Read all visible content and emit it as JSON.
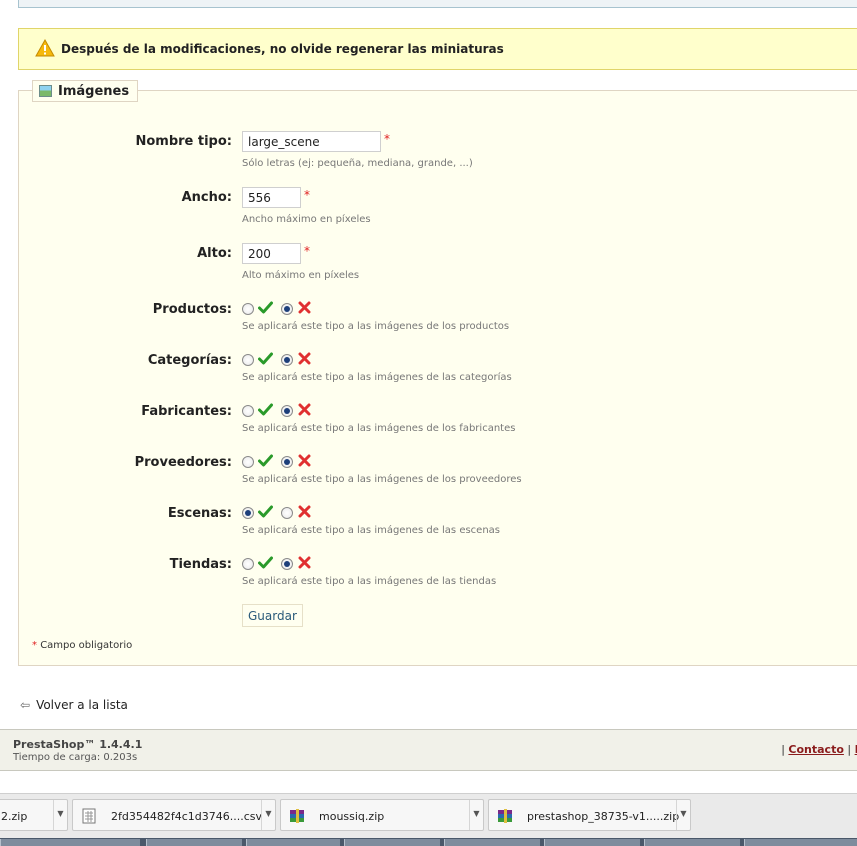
{
  "warning": {
    "text": "Después de la modificaciones, no olvide regenerar las miniaturas"
  },
  "form": {
    "legend": "Imágenes",
    "fields": [
      {
        "label": "Nombre tipo:",
        "value": "large_scene",
        "hint": "Sólo letras (ej: pequeña, mediana, grande, ...)"
      },
      {
        "label": "Ancho:",
        "value": "556",
        "hint": "Ancho máximo en píxeles"
      },
      {
        "label": "Alto:",
        "value": "200",
        "hint": "Alto máximo en píxeles"
      }
    ],
    "required_mark": "*",
    "toggles": [
      {
        "label": "Productos:",
        "enabled": false,
        "hint": "Se aplicará este tipo a las imágenes de los productos"
      },
      {
        "label": "Categorías:",
        "enabled": false,
        "hint": "Se aplicará este tipo a las imágenes de las categorías"
      },
      {
        "label": "Fabricantes:",
        "enabled": false,
        "hint": "Se aplicará este tipo a las imágenes de los fabricantes"
      },
      {
        "label": "Proveedores:",
        "enabled": false,
        "hint": "Se aplicará este tipo a las imágenes de los proveedores"
      },
      {
        "label": "Escenas:",
        "enabled": true,
        "hint": "Se aplicará este tipo a las imágenes de las escenas"
      },
      {
        "label": "Tiendas:",
        "enabled": false,
        "hint": "Se aplicará este tipo a las imágenes de las tiendas"
      }
    ],
    "save_label": "Guardar",
    "required_note": "Campo obligatorio"
  },
  "back_link": "Volver a la lista",
  "footer": {
    "brand": "PrestaShop™ 1.4.4.1",
    "load_time": "Tiempo de carga: 0.203s",
    "sep": "|",
    "contact": "Contacto",
    "sep2": "|",
    "next": "B"
  },
  "downloads": [
    {
      "name": "2.zip",
      "icon": "zip-archive-icon"
    },
    {
      "name": "2fd354482f4c1d3746....csv",
      "icon": "csv-file-icon"
    },
    {
      "name": "moussiq.zip",
      "icon": "zip-archive-icon"
    },
    {
      "name": "prestashop_38735-v1.....zip",
      "icon": "zip-archive-icon"
    }
  ],
  "colors": {
    "accent_ok": "#2a9a2a",
    "accent_no": "#e03030",
    "panel_bg": "#ffffef",
    "warning_bg": "#ffffcc"
  }
}
